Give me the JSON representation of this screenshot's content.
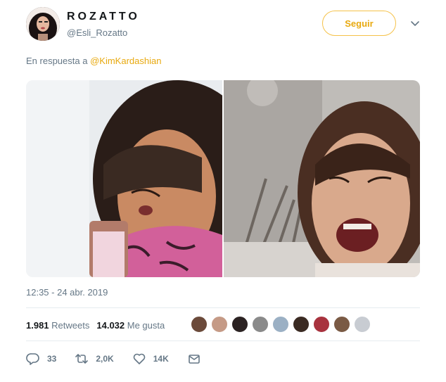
{
  "tweet": {
    "author": {
      "display_name": "ROZATTO",
      "handle": "@Esli_Rozatto"
    },
    "follow_label": "Seguir",
    "reply_prefix": "En respuesta a",
    "reply_mention": "@KimKardashian",
    "timestamp": "12:35 - 24 abr. 2019",
    "stats": {
      "retweets_count": "1.981",
      "retweets_label": "Retweets",
      "likes_count": "14.032",
      "likes_label": "Me gusta"
    },
    "liker_count_shown": 9,
    "actions": {
      "replies": "33",
      "retweets": "2,0K",
      "likes": "14K"
    }
  },
  "icons": {
    "caret": "chevron-down-icon",
    "reply": "reply-icon",
    "retweet": "retweet-icon",
    "like": "heart-icon",
    "message": "envelope-icon"
  },
  "colors": {
    "accent": "#e8a90f",
    "secondary_text": "#657786",
    "divider": "#e6ecf0"
  }
}
